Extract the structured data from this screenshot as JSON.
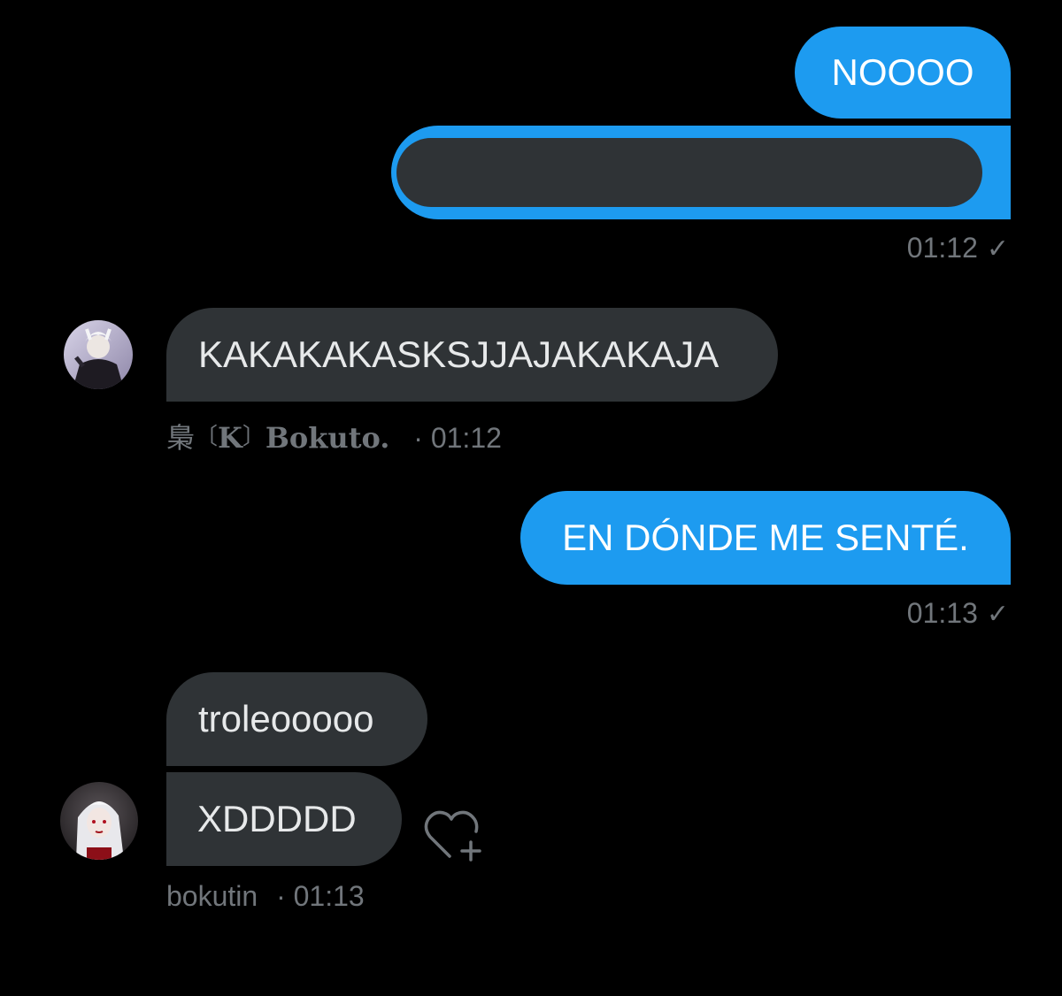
{
  "conversation": {
    "messages": [
      {
        "id": "m1",
        "direction": "outgoing",
        "text": "NOOOO"
      },
      {
        "id": "m2",
        "direction": "outgoing",
        "text": "",
        "note": "redacted"
      },
      {
        "id": "m3",
        "direction": "incoming",
        "text": "KAKAKAKASKSJJAJAKAKAJA"
      },
      {
        "id": "m4",
        "direction": "outgoing",
        "text": "EN DÓNDE ME SENTÉ."
      },
      {
        "id": "m5",
        "direction": "incoming",
        "text": "troleooooo"
      },
      {
        "id": "m6",
        "direction": "incoming",
        "text": "XDDDDD"
      }
    ],
    "meta": {
      "out1_time": "01:12",
      "out2_time": "01:13",
      "in1_sender_kanji": "梟",
      "in1_sender_open": "〔",
      "in1_sender_letter": "K",
      "in1_sender_close": "〕",
      "in1_sender_rest": "Bokuto.",
      "in1_time": "· 01:12",
      "in2_sender": "bokutin",
      "in2_time": "· 01:13"
    },
    "icons": {
      "read_receipt": "checkmark-icon",
      "react": "heart-plus-icon"
    }
  },
  "colors": {
    "background": "#000000",
    "outgoing_bubble": "#1d9bf0",
    "incoming_bubble": "#2f3336",
    "meta_text": "#71767b"
  }
}
